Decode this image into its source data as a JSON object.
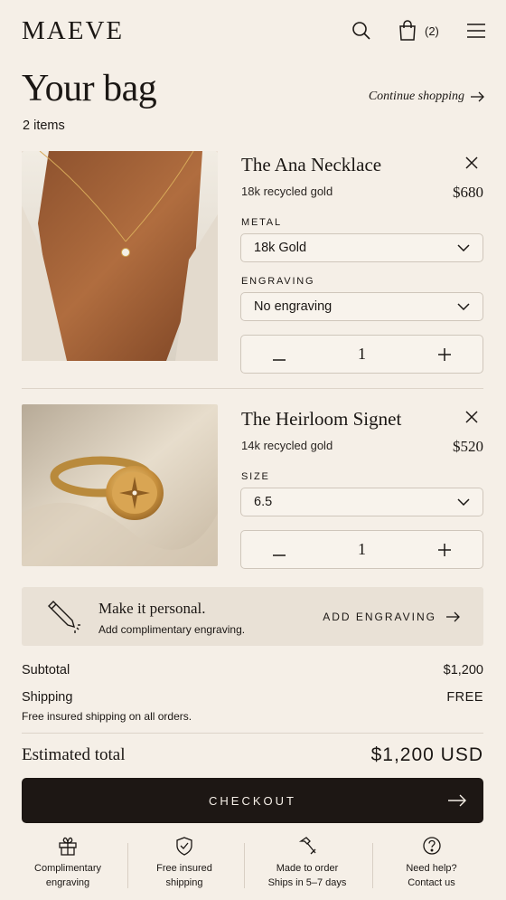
{
  "header": {
    "logo": "MAEVE",
    "bag_count": "(2)"
  },
  "page": {
    "title": "Your bag",
    "items_count": "2 items",
    "continue_label": "Continue shopping"
  },
  "items": [
    {
      "name": "The Ana Necklace",
      "material": "18k recycled gold",
      "price": "$680",
      "options": [
        {
          "label": "METAL",
          "value": "18k Gold"
        },
        {
          "label": "ENGRAVING",
          "value": "No engraving"
        }
      ],
      "quantity": "1"
    },
    {
      "name": "The Heirloom Signet",
      "material": "14k recycled gold",
      "price": "$520",
      "options": [
        {
          "label": "SIZE",
          "value": "6.5"
        }
      ],
      "quantity": "1"
    }
  ],
  "promo": {
    "title": "Make it personal.",
    "subtitle": "Add complimentary engraving.",
    "cta": "ADD ENGRAVING"
  },
  "summary": {
    "subtotal_label": "Subtotal",
    "subtotal_value": "$1,200",
    "shipping_label": "Shipping",
    "shipping_value": "FREE",
    "shipping_note": "Free insured shipping on all orders.",
    "estimated_label": "Estimated total",
    "estimated_value": "$1,200 USD"
  },
  "checkout_label": "CHECKOUT",
  "features": [
    {
      "icon": "gift-icon",
      "line1": "Complimentary",
      "line2": "engraving"
    },
    {
      "icon": "shield-check-icon",
      "line1": "Free insured",
      "line2": "shipping"
    },
    {
      "icon": "hammer-icon",
      "line1": "Made to order",
      "line2": "Ships in 5–7 days"
    },
    {
      "icon": "help-circle-icon",
      "line1": "Need help?",
      "line2": "Contact us"
    }
  ],
  "colors": {
    "background": "#f5efe7",
    "text": "#1b1714",
    "button": "#1d1714",
    "promo_bg": "#e9e1d6"
  }
}
